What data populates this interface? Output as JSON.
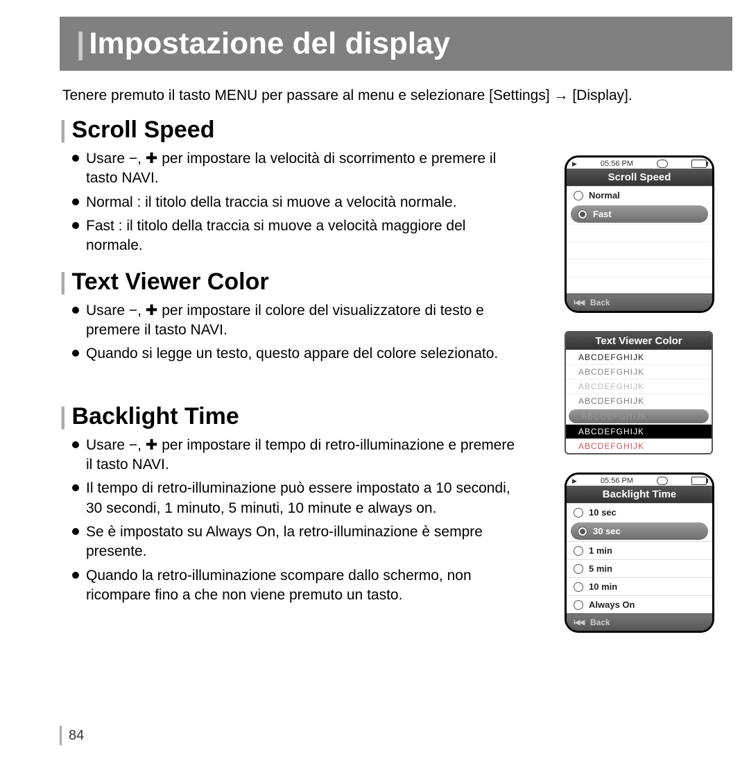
{
  "title": "Impostazione del display",
  "intro": "Tenere premuto il tasto MENU per passare al menu e selezionare [Settings] → [Display].",
  "s1": {
    "heading": "Scroll Speed",
    "b1": "Usare −, ✚ per impostare la velocità di scorrimento e premere il tasto NAVI.",
    "b2": "Normal : il titolo della traccia si muove a velocità normale.",
    "b3": "Fast : il titolo della traccia si muove a velocità maggiore del normale."
  },
  "s2": {
    "heading": "Text Viewer Color",
    "b1": "Usare −, ✚ per impostare il colore del visualizzatore di testo e premere il tasto NAVI.",
    "b2": "Quando si legge un testo, questo appare del colore selezionato."
  },
  "s3": {
    "heading": "Backlight Time",
    "b1": "Usare −, ✚ per impostare il tempo di retro-illuminazione e premere il tasto NAVI.",
    "b2": "Il tempo di retro-illuminazione può essere impostato a 10 secondi, 30 secondi, 1 minuto, 5 minuti, 10 minute e always on.",
    "b3": "Se è impostato su Always On, la retro-illuminazione è sempre presente.",
    "b4": "Quando la retro-illuminazione scompare dallo schermo, non ricompare fino a che non viene premuto un tasto."
  },
  "dev_time": "05:56 PM",
  "back_label": "Back",
  "dev1": {
    "title": "Scroll Speed",
    "items": [
      "Normal",
      "Fast"
    ],
    "selected": 1
  },
  "dev2": {
    "title": "Text Viewer Color",
    "sample": "ABCDEFGHIJK",
    "rows": [
      {
        "color": "#222"
      },
      {
        "color": "#888"
      },
      {
        "color": "#bbb"
      },
      {
        "color": "#777"
      },
      {
        "color": "#999",
        "sel": true
      },
      {
        "color": "#fff",
        "black": true
      },
      {
        "color": "#c55"
      }
    ]
  },
  "dev3": {
    "title": "Backlight Time",
    "items": [
      "10 sec",
      "30 sec",
      "1 min",
      "5 min",
      "10 min",
      "Always On"
    ],
    "selected": 1
  },
  "pagenum": "84"
}
